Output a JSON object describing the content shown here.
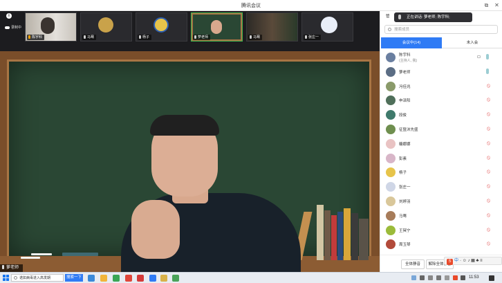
{
  "window": {
    "title": "腾讯会议"
  },
  "stage": {
    "recording_label": "录制中",
    "speaker_label": "萝老师",
    "thumbnails": [
      {
        "name": "陈宇科",
        "is_me": true
      },
      {
        "name": "马骞",
        "is_me": false
      },
      {
        "name": "杨子",
        "is_me": false
      },
      {
        "name": "萝老师",
        "is_me": false,
        "active": true
      },
      {
        "name": "马骞",
        "is_me": false
      },
      {
        "name": "张庄一",
        "is_me": false
      }
    ]
  },
  "panel": {
    "title": "管",
    "toast": "正在讲话: 萝老师; 陈宇科;",
    "search_placeholder": "搜索成员",
    "tabs": [
      {
        "label": "会议中(14)",
        "active": true
      },
      {
        "label": "未入会",
        "active": false
      }
    ],
    "members": [
      {
        "name": "陈宇科",
        "role": "(主持人, 我)",
        "avatar_color": "#6a7fa0",
        "cam": true,
        "mic": "on",
        "host": true
      },
      {
        "name": "萝老师",
        "role": "",
        "avatar_color": "#5b6d84",
        "mic": "on"
      },
      {
        "name": "冯佳兆",
        "role": "",
        "avatar_color": "#8a9a6a",
        "mic": "off"
      },
      {
        "name": "申泽阳",
        "role": "",
        "avatar_color": "#4f6f5a",
        "mic": "off"
      },
      {
        "name": "段俊",
        "role": "",
        "avatar_color": "#3f7a6c",
        "mic": "off"
      },
      {
        "name": "征暨沐先盛",
        "role": "",
        "avatar_color": "#6f8f4f",
        "mic": "off"
      },
      {
        "name": "糖娜娜",
        "role": "",
        "avatar_color": "#e9c3c3",
        "mic": "off"
      },
      {
        "name": "彭素",
        "role": "",
        "avatar_color": "#d8b6c8",
        "mic": "off"
      },
      {
        "name": "杨子",
        "role": "",
        "avatar_color": "#e7c44a",
        "mic": "off"
      },
      {
        "name": "张庄一",
        "role": "",
        "avatar_color": "#cfd6e6",
        "mic": "off"
      },
      {
        "name": "刘婷羽",
        "role": "",
        "avatar_color": "#d9c79a",
        "mic": "off"
      },
      {
        "name": "马骞",
        "role": "",
        "avatar_color": "#a77c5a",
        "mic": "off"
      },
      {
        "name": "王冥宁",
        "role": "",
        "avatar_color": "#9bbb3a",
        "mic": "off"
      },
      {
        "name": "周玉琴",
        "role": "",
        "avatar_color": "#b24a3a",
        "mic": "off"
      }
    ],
    "footer": {
      "mute_all": "全体静音",
      "unmute_all": "解除全体静音"
    },
    "ime": {
      "logo": "S",
      "mode": "中"
    }
  },
  "taskbar": {
    "search_text": "诺如病毒进入高发期",
    "search_button": "搜索一下",
    "time": "11:53"
  },
  "colors": {
    "accent": "#2f7bf5",
    "muted_mic": "#e35b5b",
    "active_border": "#3fb950"
  }
}
